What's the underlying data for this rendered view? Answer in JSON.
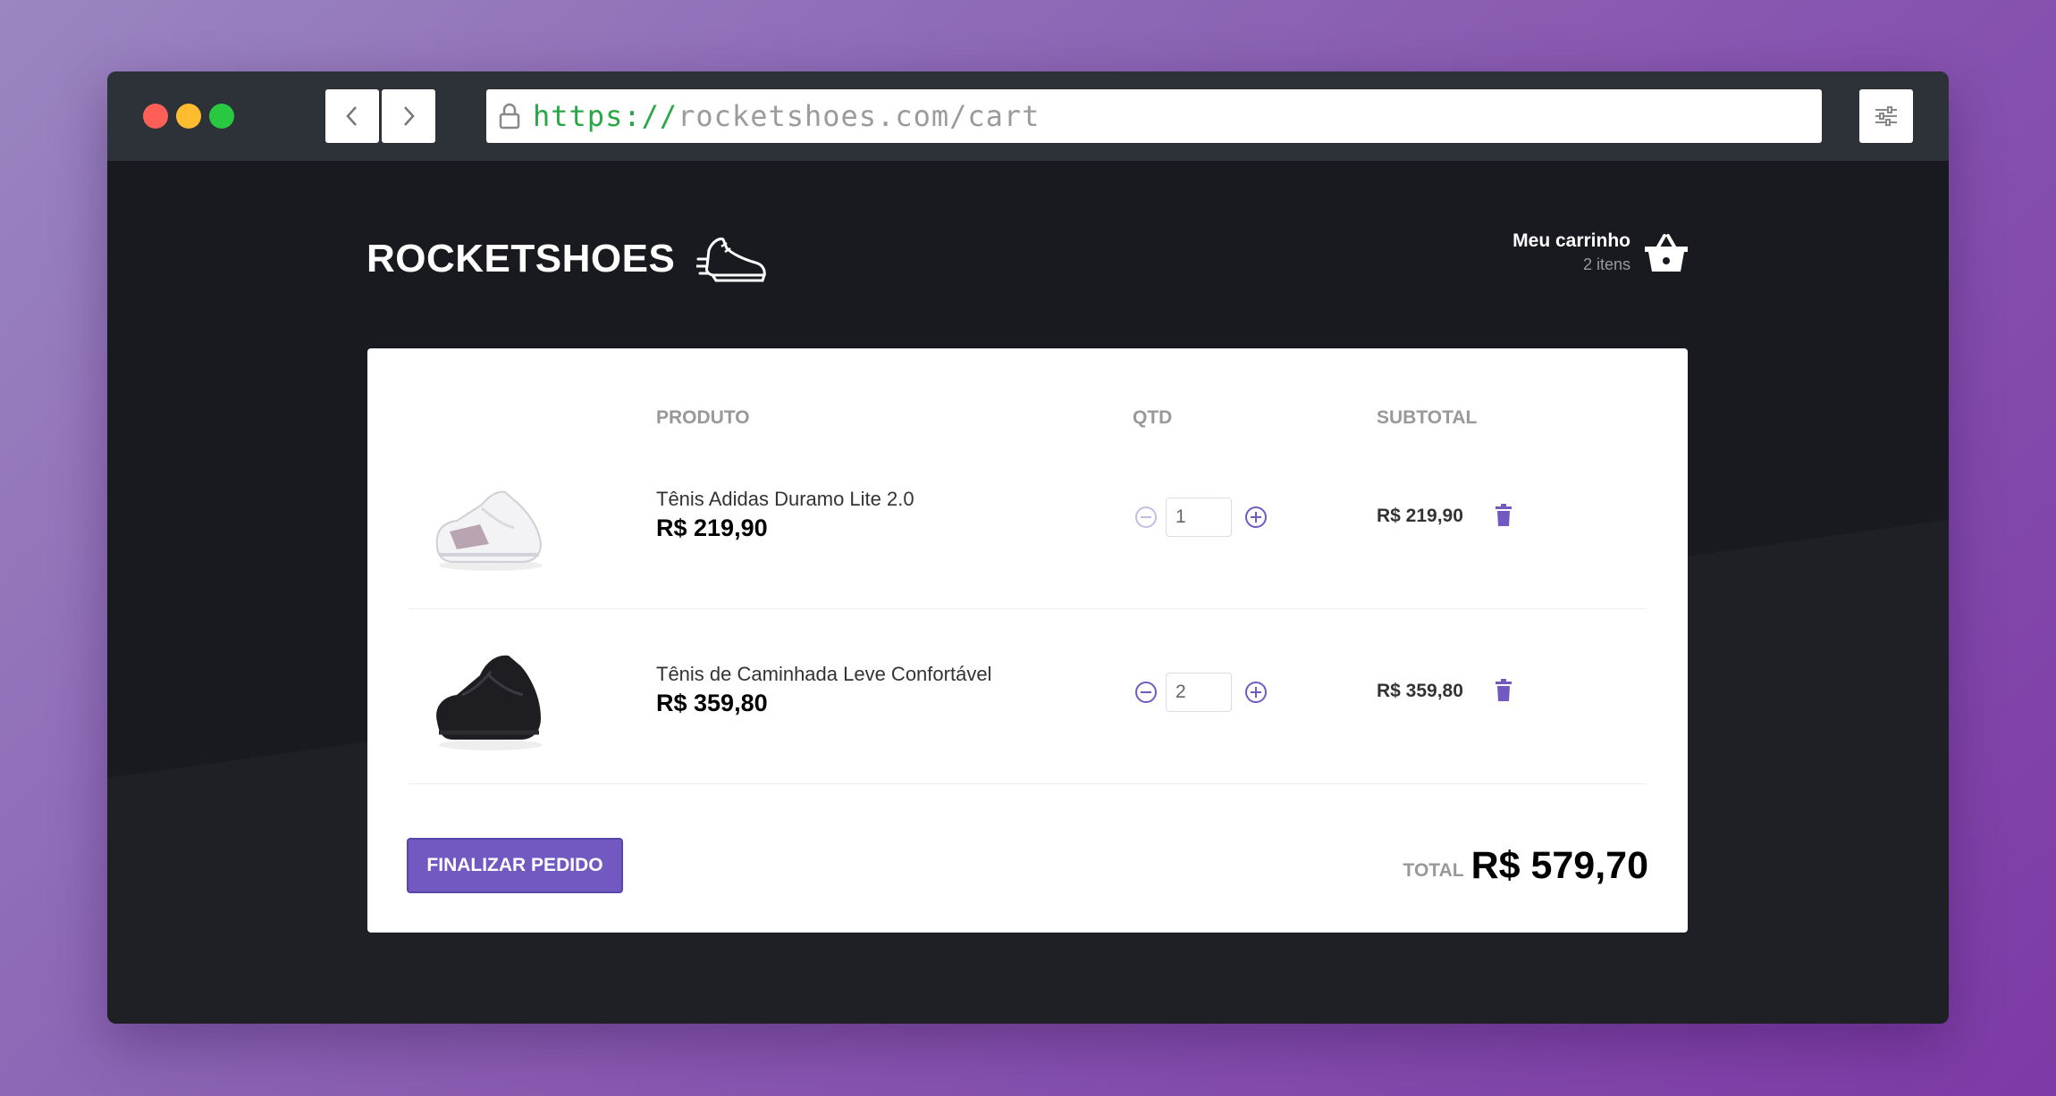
{
  "browser": {
    "url_scheme": "https://",
    "url_rest": "rocketshoes.com/cart",
    "icons": {
      "back": "chevron-left-icon",
      "forward": "chevron-right-icon",
      "lock": "lock-icon",
      "settings": "sliders-icon"
    }
  },
  "header": {
    "logo_text": "ROCKETSHOES",
    "cart_title": "Meu carrinho",
    "cart_count": "2 itens"
  },
  "table": {
    "headers": {
      "product": "PRODUTO",
      "qty": "QTD",
      "subtotal": "SUBTOTAL"
    }
  },
  "items": [
    {
      "name": "Tênis Adidas Duramo Lite 2.0",
      "price": "R$ 219,90",
      "quantity": "1",
      "subtotal": "R$ 219,90",
      "color": "white"
    },
    {
      "name": "Tênis de Caminhada Leve Confortável",
      "price": "R$ 359,80",
      "quantity": "2",
      "subtotal": "R$ 359,80",
      "color": "black"
    }
  ],
  "footer": {
    "checkout_label": "FINALIZAR PEDIDO",
    "total_label": "TOTAL",
    "total_value": "R$ 579,70"
  },
  "colors": {
    "accent": "#7159c1",
    "background": "#191920",
    "chrome": "#2d3239"
  }
}
